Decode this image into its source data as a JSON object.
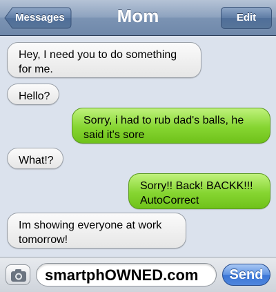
{
  "header": {
    "back_label": "Messages",
    "title": "Mom",
    "edit_label": "Edit"
  },
  "messages": [
    {
      "from": "contact",
      "text": "Hey, I need you to do something for me."
    },
    {
      "from": "contact",
      "text": "Hello?"
    },
    {
      "from": "me",
      "text": "Sorry, i had to rub dad's balls, he said it's sore"
    },
    {
      "from": "contact",
      "text": "What!?"
    },
    {
      "from": "me",
      "text": "Sorry!! Back! BACKK!!! AutoCorrect"
    },
    {
      "from": "contact",
      "text": "Im showing everyone at work tomorrow!"
    }
  ],
  "composer": {
    "text_value": "smartphOWNED.com",
    "send_label": "Send",
    "camera_icon": "camera-icon"
  },
  "colors": {
    "received_bubble": "#e8e8e8",
    "sent_bubble": "#86d531",
    "send_button": "#3b76d6",
    "navbar": "#7b93b3"
  }
}
